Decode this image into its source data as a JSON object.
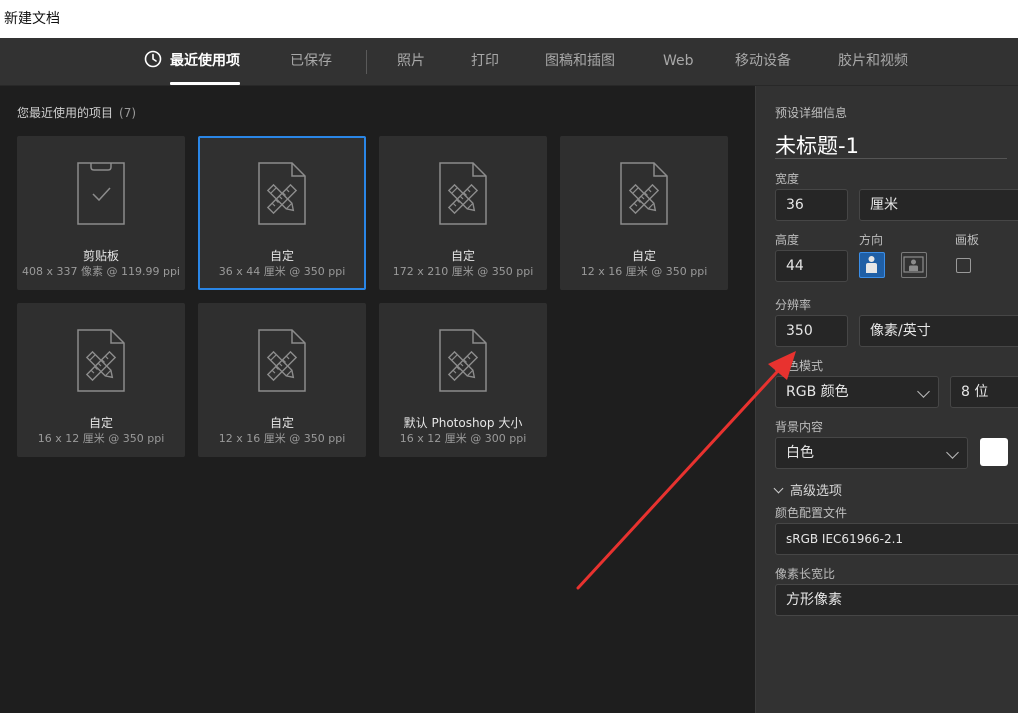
{
  "window": {
    "title": "新建文档"
  },
  "tabs": [
    "最近使用项",
    "已保存",
    "照片",
    "打印",
    "图稿和插图",
    "Web",
    "移动设备",
    "胶片和视频"
  ],
  "recent": {
    "label": "您最近使用的项目",
    "count": "(7)",
    "items": [
      {
        "icon": "clipboard-icon",
        "name": "剪贴板",
        "size": "408 x 337 像素 @ 119.99 ppi"
      },
      {
        "icon": "custom-document-icon",
        "name": "自定",
        "size": "36 x 44 厘米 @ 350 ppi"
      },
      {
        "icon": "custom-document-icon",
        "name": "自定",
        "size": "172 x 210 厘米 @ 350 ppi"
      },
      {
        "icon": "custom-document-icon",
        "name": "自定",
        "size": "12 x 16 厘米 @ 350 ppi"
      },
      {
        "icon": "custom-document-icon",
        "name": "自定",
        "size": "16 x 12 厘米 @ 350 ppi"
      },
      {
        "icon": "custom-document-icon",
        "name": "自定",
        "size": "12 x 16 厘米 @ 350 ppi"
      },
      {
        "icon": "custom-document-icon",
        "name": "默认 Photoshop 大小",
        "size": "16 x 12 厘米 @ 300 ppi"
      }
    ]
  },
  "preset": {
    "header": "预设详细信息",
    "doc_name": "未标题-1",
    "width_label": "宽度",
    "width_value": "36",
    "width_unit": "厘米",
    "height_label": "高度",
    "height_value": "44",
    "orientation_label": "方向",
    "artboard_label": "画板",
    "resolution_label": "分辨率",
    "resolution_value": "350",
    "resolution_unit": "像素/英寸",
    "color_mode_label": "颜色模式",
    "color_mode_value": "RGB 颜色",
    "bit_depth_value": "8 位",
    "background_label": "背景内容",
    "background_value": "白色",
    "advanced_label": "高级选项",
    "color_profile_label": "颜色配置文件",
    "color_profile_value": "sRGB IEC61966-2.1",
    "pixel_aspect_label": "像素长宽比",
    "pixel_aspect_value": "方形像素"
  },
  "colors": {
    "accent": "#2a86e6",
    "annotation_arrow": "#e8322f",
    "background_swatch": "#ffffff"
  }
}
